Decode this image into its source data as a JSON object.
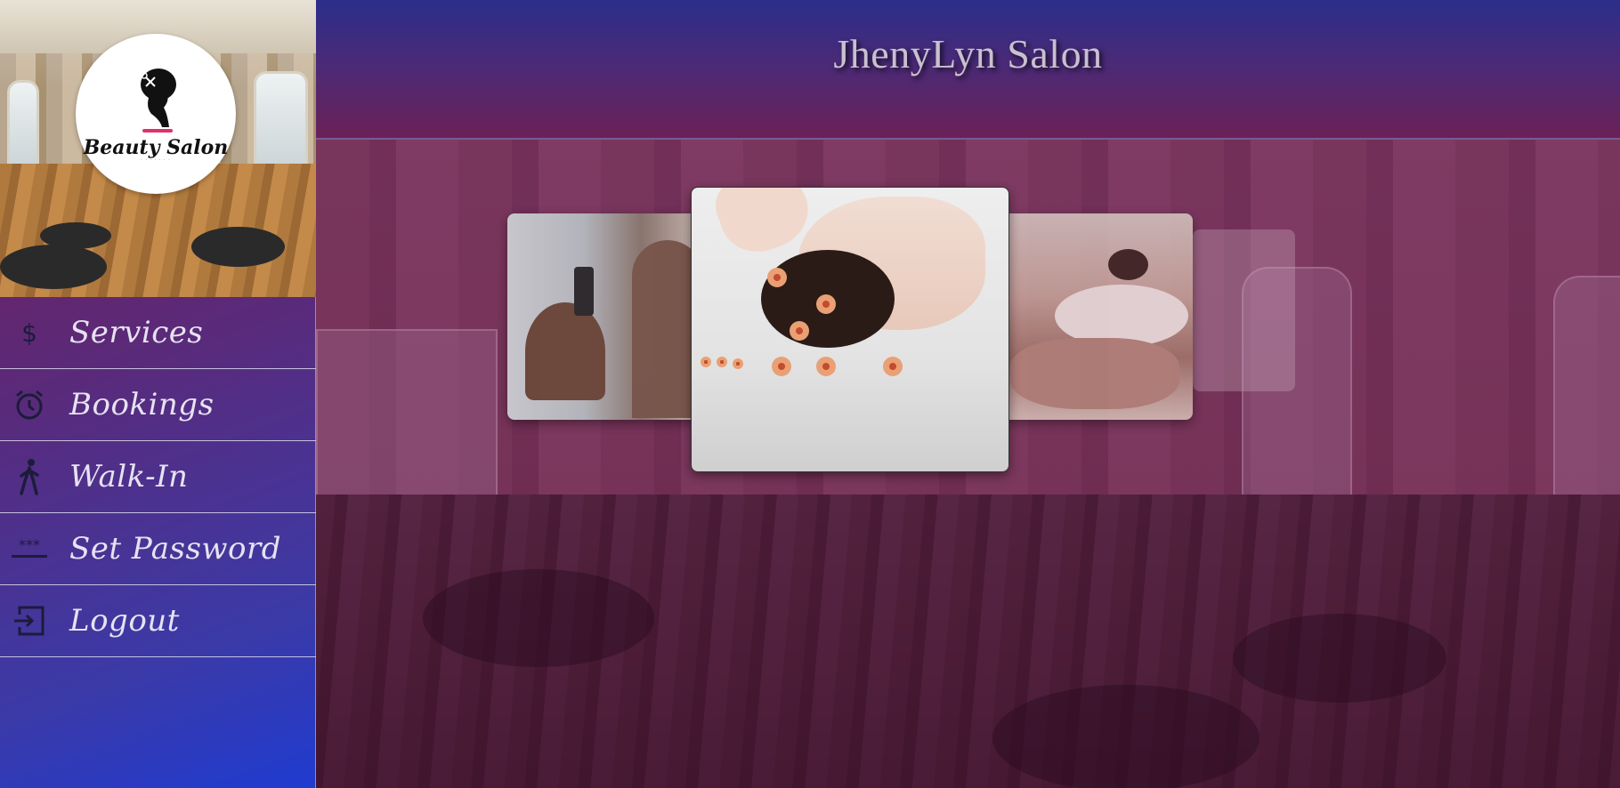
{
  "app": {
    "title": "JhenyLyn Salon"
  },
  "logo": {
    "brand_text": "Beauty Salon"
  },
  "sidebar": {
    "items": [
      {
        "label": "Services",
        "icon": "dollar-icon"
      },
      {
        "label": "Bookings",
        "icon": "alarm-clock-icon"
      },
      {
        "label": "Walk-In",
        "icon": "walking-person-icon"
      },
      {
        "label": "Set Password",
        "icon": "password-icon"
      },
      {
        "label": "Logout",
        "icon": "logout-icon"
      }
    ]
  },
  "carousel": {
    "slides": [
      {
        "subject": "hair-styling"
      },
      {
        "subject": "facial-spa"
      },
      {
        "subject": "massage"
      }
    ],
    "active_index": 1
  },
  "colors": {
    "sidebar_top": "#7a1d4f",
    "sidebar_bottom": "#1f3bd0",
    "header_top": "#2b2e8a",
    "header_bottom": "#6a2157",
    "nav_text": "#e6e2f2",
    "title_text": "#c8c0cf"
  }
}
